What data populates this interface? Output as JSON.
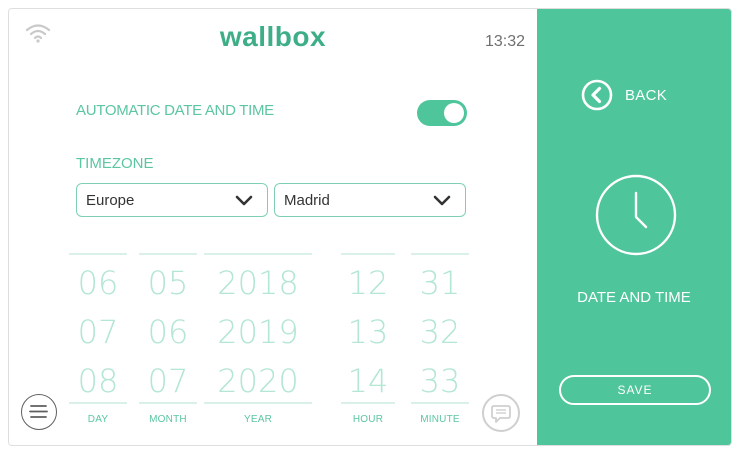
{
  "header": {
    "logo": "wallbox",
    "time": "13:32",
    "icons": {
      "wifi": "wifi-icon"
    }
  },
  "settings": {
    "automatic_label": "AUTOMATIC DATE AND TIME",
    "automatic_enabled": true,
    "timezone_label": "TIMEZONE",
    "region": "Europe",
    "city": "Madrid"
  },
  "pickers": {
    "day": {
      "label": "DAY",
      "values": [
        "06",
        "07",
        "08"
      ]
    },
    "month": {
      "label": "MONTH",
      "values": [
        "05",
        "06",
        "07"
      ]
    },
    "year": {
      "label": "YEAR",
      "values": [
        "2018",
        "2019",
        "2020"
      ]
    },
    "hour": {
      "label": "HOUR",
      "values": [
        "12",
        "13",
        "14"
      ]
    },
    "minute": {
      "label": "MINUTE",
      "values": [
        "31",
        "32",
        "33"
      ]
    }
  },
  "sidebar": {
    "back_label": "BACK",
    "title": "DATE AND TIME",
    "save_label": "SAVE",
    "icons": {
      "back": "back-chevron-icon",
      "clock": "clock-icon"
    }
  },
  "footer": {
    "icons": {
      "menu": "menu-icon",
      "chat": "chat-icon"
    }
  },
  "colors": {
    "accent": "#4fc59b",
    "logo": "#3eae86",
    "picker_text": "#b3e6d3",
    "white": "#ffffff"
  }
}
